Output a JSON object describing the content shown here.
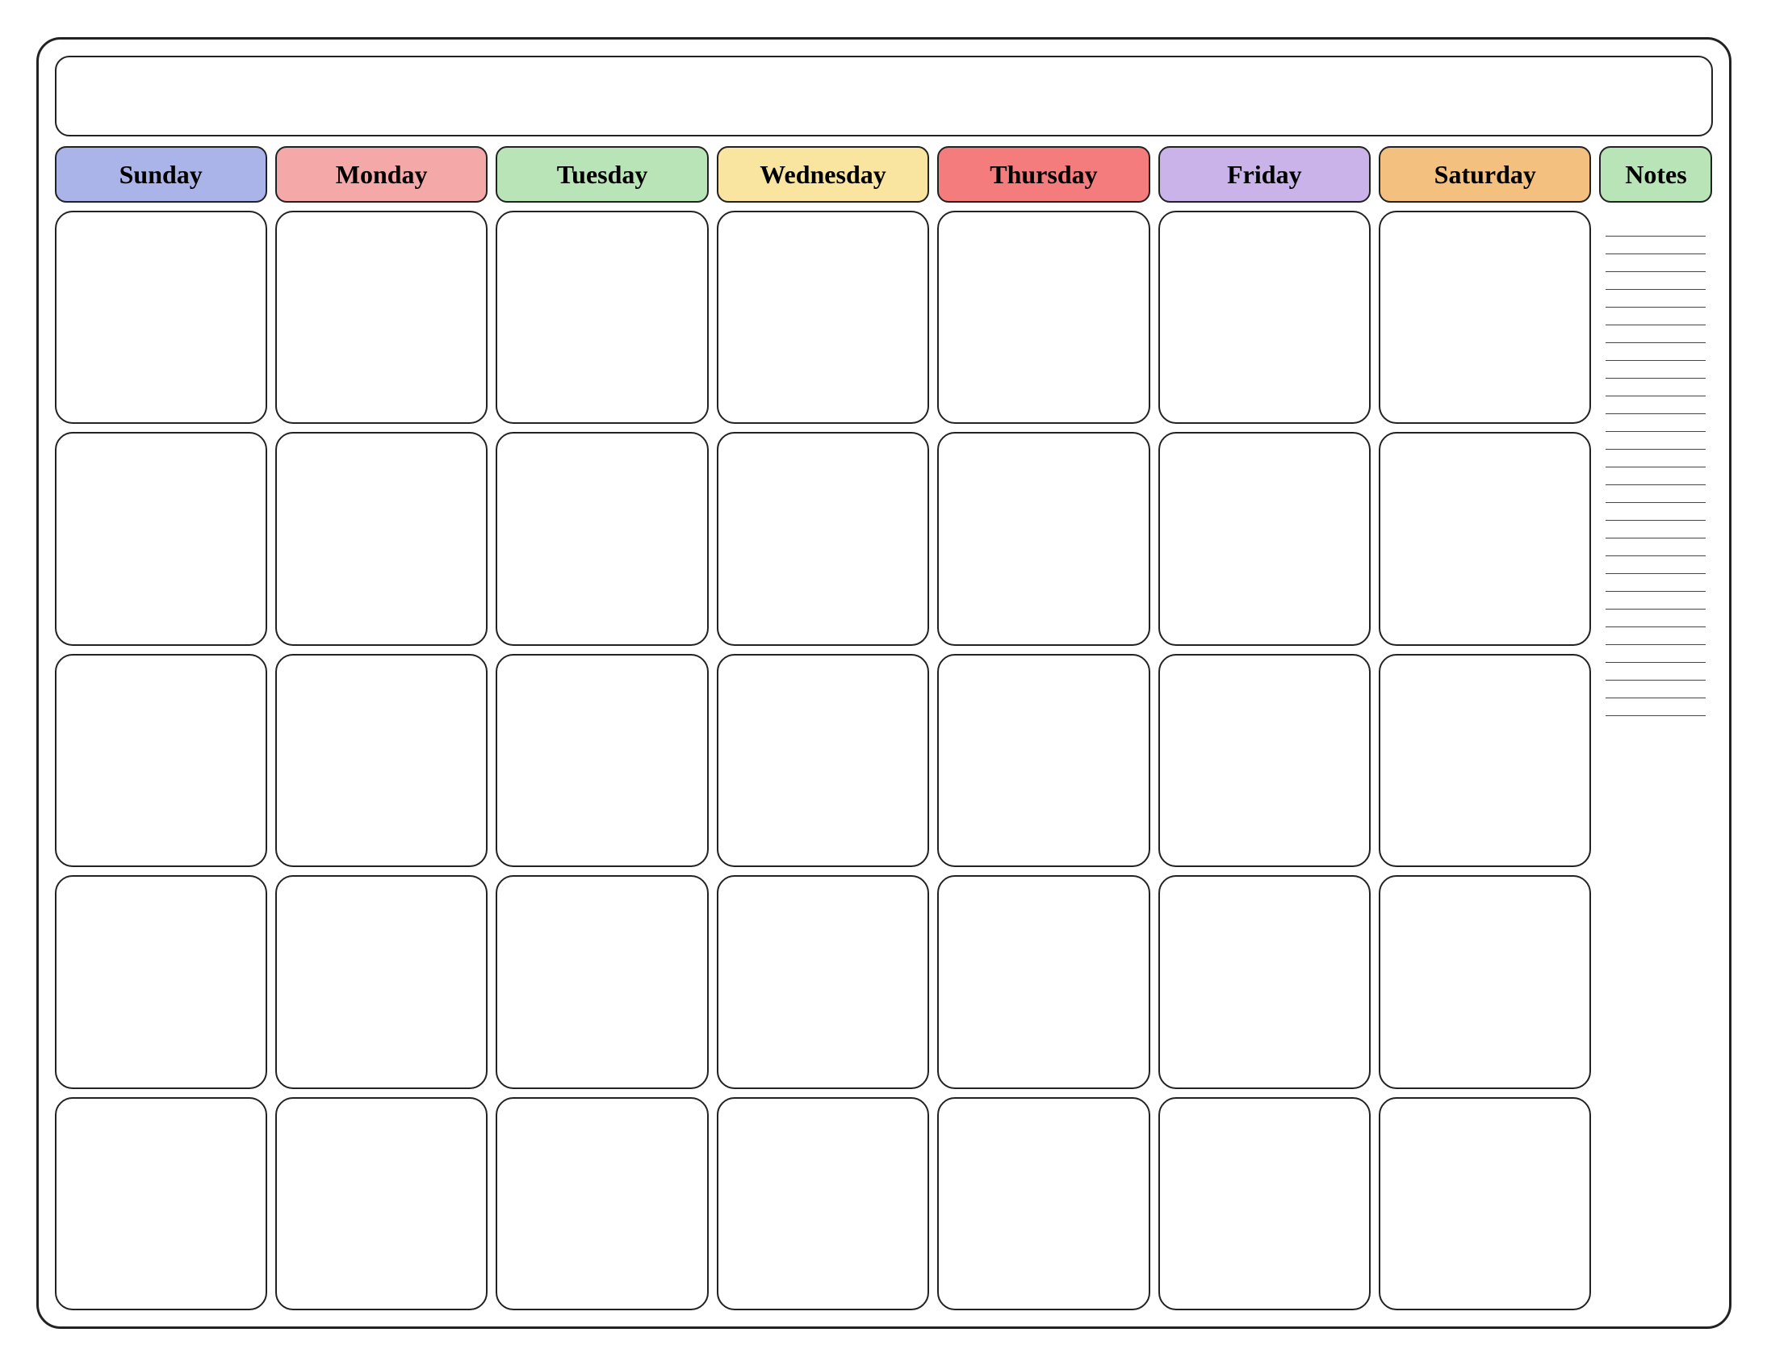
{
  "header": {
    "title": ""
  },
  "days": {
    "sunday": "Sunday",
    "monday": "Monday",
    "tuesday": "Tuesday",
    "wednesday": "Wednesday",
    "thursday": "Thursday",
    "friday": "Friday",
    "saturday": "Saturday",
    "notes": "Notes"
  },
  "notes_lines": 28,
  "rows": 5
}
